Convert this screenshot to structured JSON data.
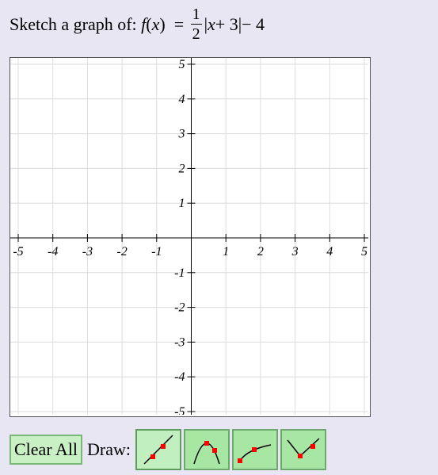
{
  "question": {
    "prompt": "Sketch a graph of:",
    "func": "f",
    "var": "x",
    "equals": "=",
    "num": "1",
    "den": "2",
    "abs_inner_var": "x",
    "abs_inner_rest": " + 3",
    "tail": " − 4"
  },
  "graph": {
    "x_range": [
      -5,
      5
    ],
    "y_range": [
      -5,
      5
    ],
    "grid": true,
    "x_tick_labels": [
      "-5",
      "-4",
      "-3",
      "-2",
      "-1",
      "1",
      "2",
      "3",
      "4",
      "5"
    ],
    "y_tick_labels": [
      "5",
      "4",
      "3",
      "2",
      "1",
      "-1",
      "-2",
      "-3",
      "-4",
      "-5"
    ]
  },
  "toolbar": {
    "clear_label": "Clear All",
    "draw_label": "Draw:",
    "tools": [
      {
        "name": "line-tool",
        "icon": "line-icon",
        "active": true
      },
      {
        "name": "parabola-tool",
        "icon": "parabola-icon",
        "active": false
      },
      {
        "name": "sqrt-tool",
        "icon": "sqrt-curve-icon",
        "active": false
      },
      {
        "name": "absolute-value-tool",
        "icon": "absolute-value-icon",
        "active": false
      }
    ]
  },
  "colors": {
    "grid": "#dcdcdc",
    "axis": "#000000",
    "point": "#ff0000",
    "tool_active": "#c2efc0",
    "tool_inactive": "#a8e6a3"
  }
}
